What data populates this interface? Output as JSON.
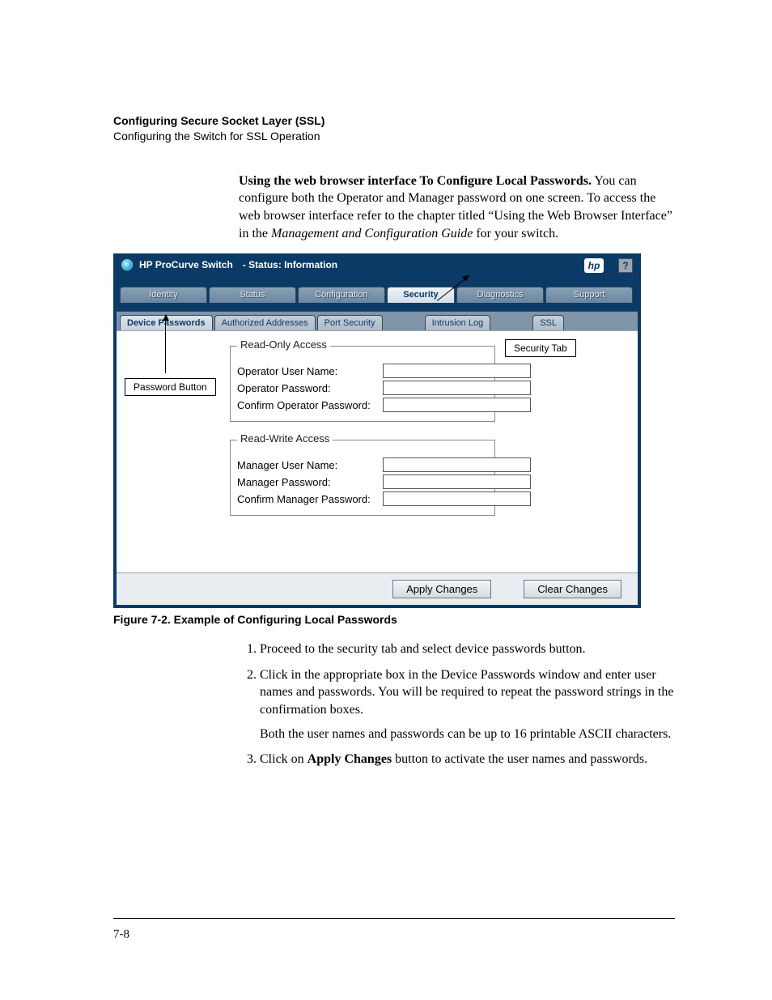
{
  "header": {
    "title": "Configuring Secure Socket Layer (SSL)",
    "subtitle": "Configuring the Switch for SSL Operation"
  },
  "intro": {
    "lead": "Using the web browser interface To Configure Local Passwords.",
    "rest1": "  You can configure both the Operator and Manager password on one screen. To access the web browser interface refer to the  chapter titled “Using the Web Browser Interface” in the ",
    "ital": "Management and Configuration Guide",
    "rest2": " for your switch."
  },
  "ui": {
    "titlebar": {
      "left": "HP ProCurve Switch",
      "right": "- Status: Information",
      "logo": "hp",
      "help": "?"
    },
    "main_tabs": [
      "Identity",
      "Status",
      "Configuration",
      "Security",
      "Diagnostics",
      "Support"
    ],
    "main_active_index": 3,
    "sub_tabs": [
      "Device Passwords",
      "Authorized Addresses",
      "Port Security",
      "Intrusion Log",
      "SSL"
    ],
    "sub_active_index": 0,
    "callouts": {
      "password_button": "Password Button",
      "security_tab": "Security Tab"
    },
    "groups": {
      "ro": {
        "legend": "Read-Only Access",
        "rows": [
          "Operator User Name:",
          "Operator Password:",
          "Confirm Operator Password:"
        ]
      },
      "rw": {
        "legend": "Read-Write Access",
        "rows": [
          "Manager User Name:",
          "Manager Password:",
          "Confirm Manager Password:"
        ]
      }
    },
    "buttons": {
      "apply": "Apply Changes",
      "clear": "Clear Changes"
    }
  },
  "figure_caption": "Figure 7-2. Example of Configuring Local Passwords",
  "steps": {
    "s1": "Proceed to the security tab and select device passwords button.",
    "s2": "Click in the appropriate box in the Device Passwords window and enter user names and passwords. You will be required to repeat the password strings in the confirmation boxes.",
    "s2b": "Both the user names and passwords can be up to 16 printable ASCII characters.",
    "s3a": "Click on ",
    "s3bold": "Apply Changes",
    "s3b": "  button to activate the user names and pass­words."
  },
  "page_num": "7-8"
}
